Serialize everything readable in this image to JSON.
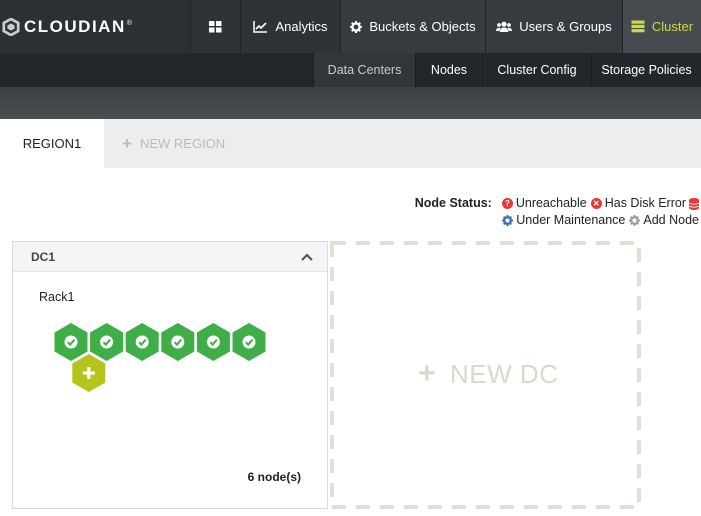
{
  "brand": {
    "name": "CLOUDIAN",
    "mark": "®"
  },
  "nav": {
    "analytics": "Analytics",
    "buckets": "Buckets & Objects",
    "users": "Users & Groups",
    "cluster": "Cluster"
  },
  "subnav": {
    "data_centers": "Data Centers",
    "nodes": "Nodes",
    "cluster_config": "Cluster Config",
    "storage_policies": "Storage Policies"
  },
  "regions": {
    "active": "REGION1",
    "new_region": "NEW REGION"
  },
  "legend": {
    "title": "Node Status:",
    "unreachable": "Unreachable",
    "disk_error": "Has Disk Error",
    "maintenance": "Under Maintenance",
    "add_node": "Add Node",
    "colors": {
      "unreachable": "#e53935",
      "disk_error": "#e53935",
      "maintenance": "#3d6fb6",
      "add_node": "#9aa0a4"
    }
  },
  "datacenter": {
    "name": "DC1",
    "rack": "Rack1",
    "node_count": "6 node(s)",
    "nodes": [
      "ok",
      "ok",
      "ok",
      "ok",
      "ok",
      "ok"
    ],
    "colors": {
      "ok": "#3fae49",
      "add": "#b4c41c"
    }
  },
  "new_dc": {
    "label": "NEW DC"
  },
  "theme": {
    "accent": "#cddc39",
    "nav_bg": "#2b3033"
  }
}
